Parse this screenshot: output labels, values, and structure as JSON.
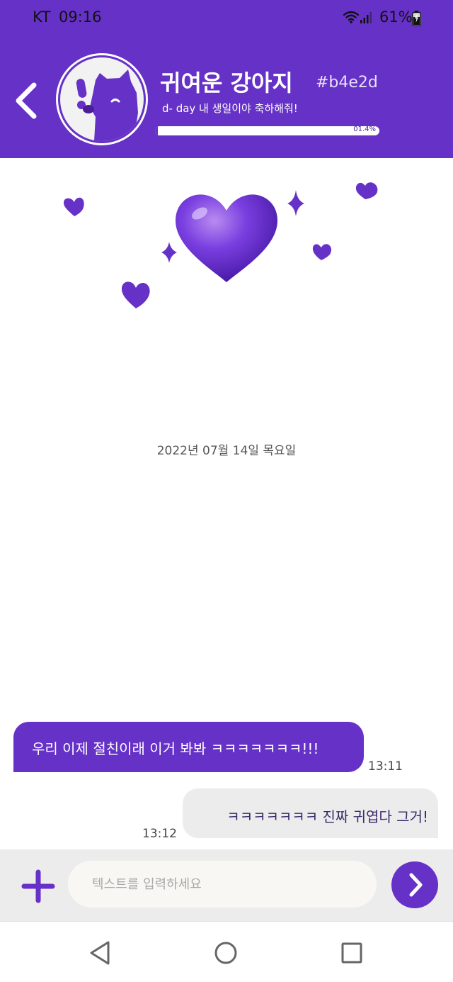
{
  "status_bar": {
    "carrier": "KT",
    "time": "09:16",
    "battery": "61%",
    "icons": [
      "wifi-icon",
      "signal-icon",
      "battery-charging-icon"
    ]
  },
  "header": {
    "back_icon": "chevron-left-icon",
    "profile_name": "귀여운 강아지",
    "profile_tag": "#b4e2d",
    "status_message": "d- day 내 생일이야 축하해줘!",
    "progress": {
      "label": "01.4%",
      "value": 1.4
    }
  },
  "chat": {
    "date_divider": "2022년 07월 14일 목요일",
    "messages": [
      {
        "side": "left",
        "text": "우리 이제 절친이래 이거 봐봐 ㅋㅋㅋㅋㅋㅋㅋ!!!",
        "time": "13:11"
      },
      {
        "side": "right",
        "text": "ㅋㅋㅋㅋㅋㅋㅋ 진짜 귀엽다 그거!",
        "time": "13:12"
      }
    ]
  },
  "composer": {
    "add_icon": "plus-icon",
    "placeholder": "텍스트를 입력하세요",
    "value": "",
    "send_icon": "chevron-right-icon"
  },
  "nav": {
    "icons": [
      "back-triangle-icon",
      "home-circle-icon",
      "recents-square-icon"
    ]
  },
  "colors": {
    "accent": "#6631c7",
    "incoming_bubble": "#ececec",
    "input_bar": "#ececec"
  }
}
